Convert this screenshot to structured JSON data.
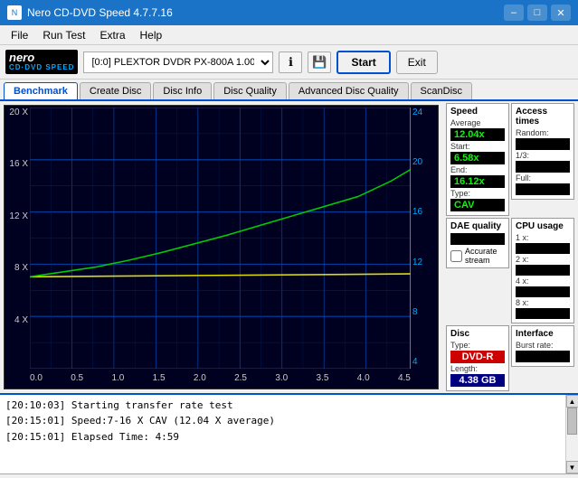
{
  "window": {
    "title": "Nero CD-DVD Speed 4.7.7.16",
    "minimize_label": "–",
    "maximize_label": "□",
    "close_label": "✕"
  },
  "menu": {
    "items": [
      "File",
      "Run Test",
      "Extra",
      "Help"
    ]
  },
  "toolbar": {
    "drive_label": "[0:0]  PLEXTOR DVDR  PX-800A 1.00",
    "start_label": "Start",
    "exit_label": "Exit"
  },
  "tabs": {
    "items": [
      "Benchmark",
      "Create Disc",
      "Disc Info",
      "Disc Quality",
      "Advanced Disc Quality",
      "ScanDisc"
    ],
    "active": "Benchmark"
  },
  "chart": {
    "y_axis_left": [
      "20 X",
      "16 X",
      "12 X",
      "8 X",
      "4 X",
      ""
    ],
    "y_axis_right": [
      "24",
      "20",
      "16",
      "12",
      "8",
      "4"
    ],
    "x_axis": [
      "0.0",
      "0.5",
      "1.0",
      "1.5",
      "2.0",
      "2.5",
      "3.0",
      "3.5",
      "4.0",
      "4.5"
    ]
  },
  "speed_panel": {
    "title": "Speed",
    "average_label": "Average",
    "average_value": "12.04x",
    "start_label": "Start:",
    "start_value": "6.58x",
    "end_label": "End:",
    "end_value": "16.12x",
    "type_label": "Type:",
    "type_value": "CAV"
  },
  "access_times_panel": {
    "title": "Access times",
    "random_label": "Random:",
    "random_value": "",
    "one_third_label": "1/3:",
    "one_third_value": "",
    "full_label": "Full:",
    "full_value": ""
  },
  "dae_quality_panel": {
    "title": "DAE quality",
    "value": "",
    "accurate_label": "Accurate stream",
    "accurate_checked": false
  },
  "cpu_usage_panel": {
    "title": "CPU usage",
    "one_x_label": "1 x:",
    "one_x_value": "",
    "two_x_label": "2 x:",
    "two_x_value": "",
    "four_x_label": "4 x:",
    "four_x_value": "",
    "eight_x_label": "8 x:",
    "eight_x_value": ""
  },
  "disc_panel": {
    "title": "Disc",
    "type_label": "Type:",
    "type_value": "DVD-R",
    "length_label": "Length:",
    "length_value": "4.38 GB"
  },
  "interface_panel": {
    "title": "Interface",
    "burst_rate_label": "Burst rate:"
  },
  "log": {
    "entries": [
      "[20:10:03]  Starting transfer rate test",
      "[20:15:01]  Speed:7-16 X CAV (12.04 X average)",
      "[20:15:01]  Elapsed Time: 4:59"
    ]
  }
}
